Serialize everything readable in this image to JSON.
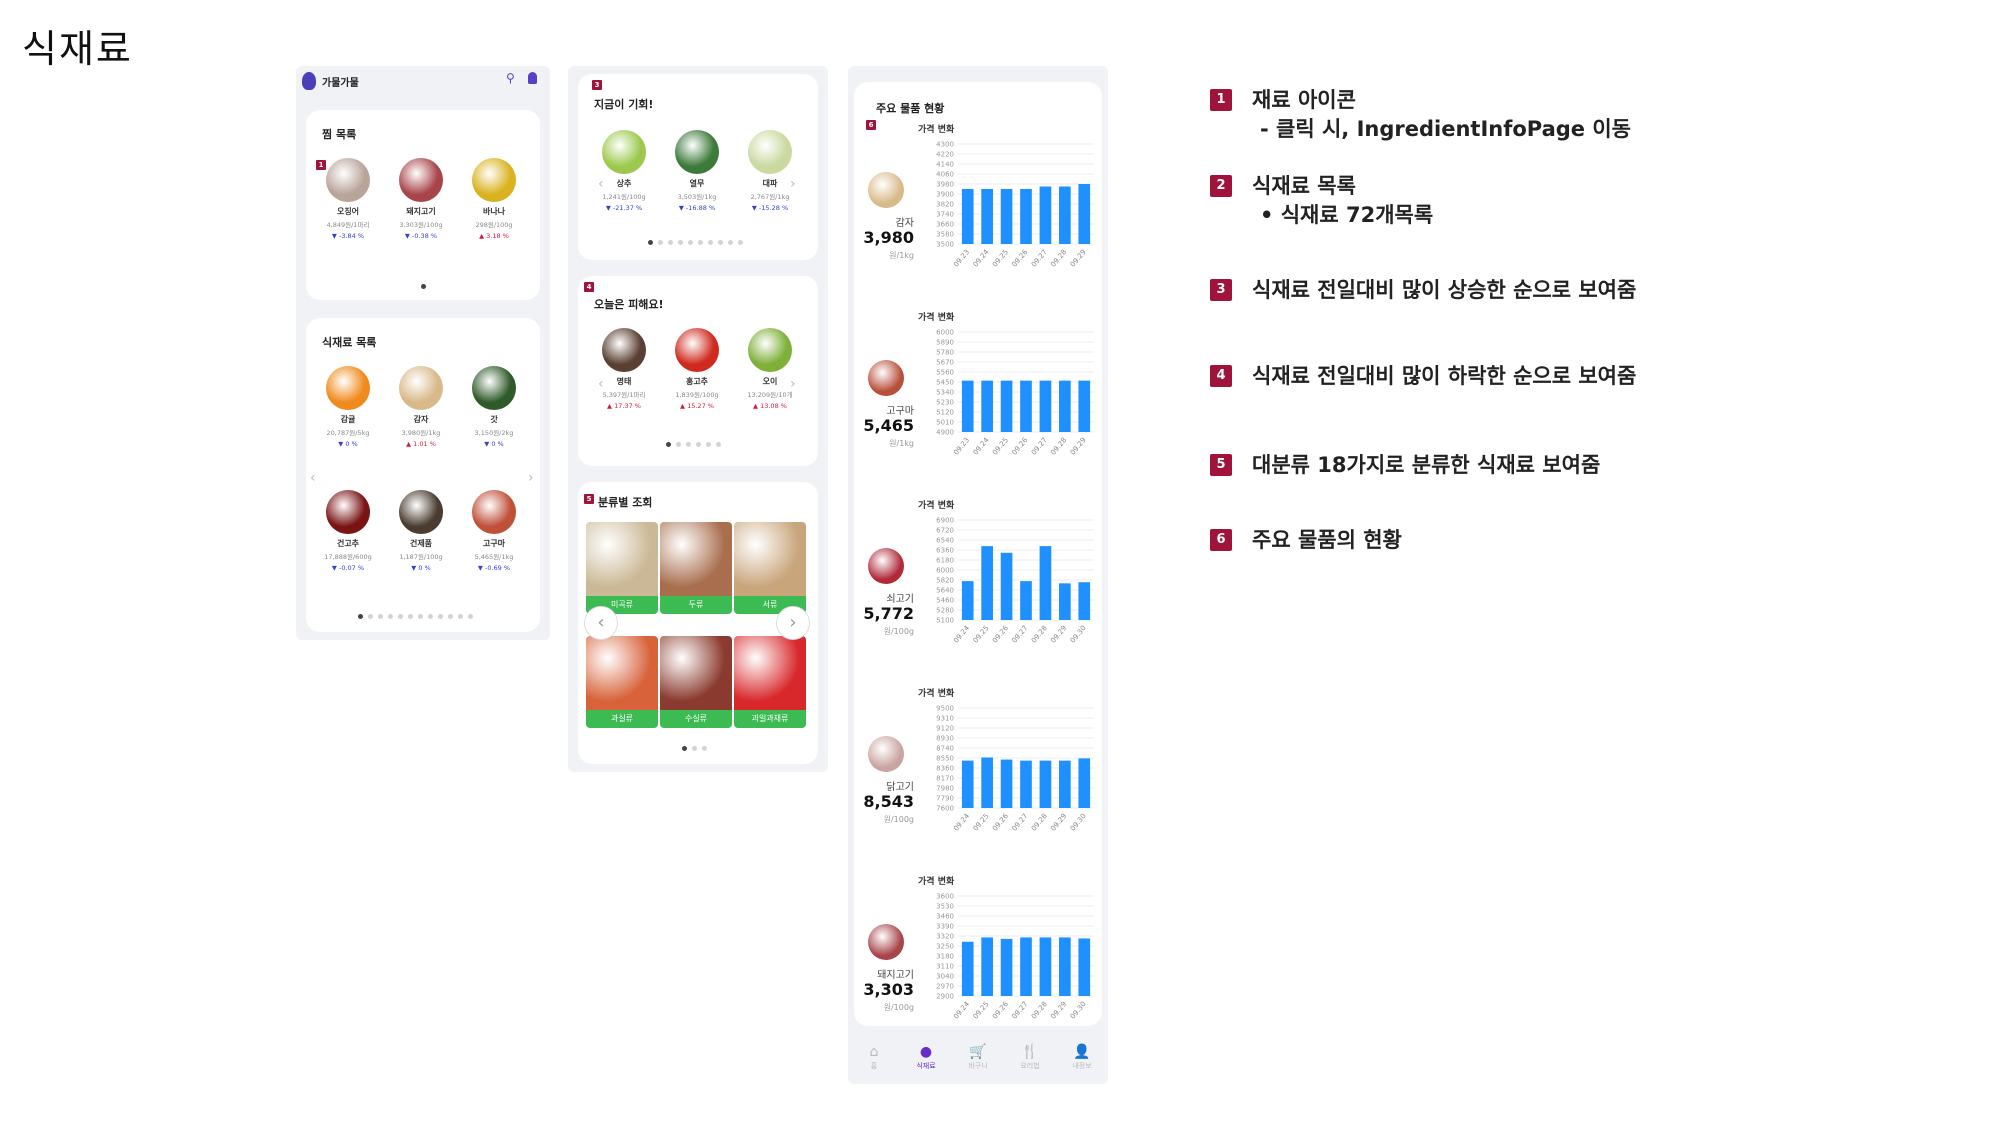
{
  "page_title": "식재료",
  "app": {
    "name": "가물가물",
    "colors": {
      "accent": "#a0143c",
      "brand": "#6a2cc7",
      "green": "#3dbb53",
      "bar": "#1e90ff",
      "down": "#3344cc",
      "up": "#d61b3a"
    }
  },
  "favorites": {
    "badge": "1",
    "title": "찜 목록",
    "items": [
      {
        "name": "오징어",
        "price": "4,849원/1마리",
        "change": "▼ -3.84 %",
        "dir": "dn",
        "color": "#b9a49a"
      },
      {
        "name": "돼지고기",
        "price": "3,303원/100g",
        "change": "▼ -0.38 %",
        "dir": "dn",
        "color": "#a8454a"
      },
      {
        "name": "바나나",
        "price": "298원/100g",
        "change": "▲ 3.18 %",
        "dir": "up",
        "color": "#d9b21f"
      }
    ]
  },
  "ingredients": {
    "badge": "2",
    "title": "식재료 목록",
    "items": [
      {
        "name": "감귤",
        "price": "20,787원/5kg",
        "change": "▼ 0 %",
        "dir": "dn",
        "color": "#f08a1c"
      },
      {
        "name": "감자",
        "price": "3,980원/1kg",
        "change": "▲ 1.01 %",
        "dir": "up",
        "color": "#d9b98a"
      },
      {
        "name": "갓",
        "price": "3,150원/2kg",
        "change": "▼ 0 %",
        "dir": "dn",
        "color": "#2f5a2a"
      },
      {
        "name": "건고추",
        "price": "17,888원/600g",
        "change": "▼ -0.07 %",
        "dir": "dn",
        "color": "#7a1414"
      },
      {
        "name": "건제품",
        "price": "1,187원/100g",
        "change": "▼ 0 %",
        "dir": "dn",
        "color": "#4a3c30"
      },
      {
        "name": "고구마",
        "price": "5,465원/1kg",
        "change": "▼ -0.69 %",
        "dir": "dn",
        "color": "#c0503a"
      }
    ]
  },
  "rising": {
    "badge": "3",
    "title": "지금이 기회!",
    "items": [
      {
        "name": "상추",
        "price": "1,241원/100g",
        "change": "▼ -21.37 %",
        "dir": "dn",
        "color": "#9cc94d"
      },
      {
        "name": "열무",
        "price": "3,503원/1kg",
        "change": "▼ -16.88 %",
        "dir": "dn",
        "color": "#3c7a3a"
      },
      {
        "name": "대파",
        "price": "2,767원/1kg",
        "change": "▼ -15.28 %",
        "dir": "dn",
        "color": "#c9d9a0"
      }
    ]
  },
  "falling": {
    "badge": "4",
    "title": "오늘은 피해요!",
    "items": [
      {
        "name": "명태",
        "price": "5,397원/1마리",
        "change": "▲ 17.37 %",
        "dir": "up",
        "color": "#5a4032"
      },
      {
        "name": "홍고추",
        "price": "1,839원/100g",
        "change": "▲ 15.27 %",
        "dir": "up",
        "color": "#cf2a1e"
      },
      {
        "name": "오이",
        "price": "13,209원/10개",
        "change": "▲ 13.08 %",
        "dir": "up",
        "color": "#7fb03a"
      }
    ]
  },
  "categories": {
    "badge": "5",
    "title": "분류별 조회",
    "items": [
      {
        "label": "미곡류",
        "color": "#cbb896"
      },
      {
        "label": "두류",
        "color": "#a86e4e"
      },
      {
        "label": "서류",
        "color": "#c9a57c"
      },
      {
        "label": "과실류",
        "color": "#d8623a"
      },
      {
        "label": "수실류",
        "color": "#8a3a2e"
      },
      {
        "label": "과일과채류",
        "color": "#d8282c"
      }
    ]
  },
  "stats": {
    "title": "주요 물품 현황",
    "badge": "6",
    "chart_title": "가격 변화",
    "items": [
      {
        "name": "감자",
        "value": "3,980",
        "unit": "원/1kg",
        "color": "#d8b98a"
      },
      {
        "name": "고구마",
        "value": "5,465",
        "unit": "원/1kg",
        "color": "#b8503a"
      },
      {
        "name": "쇠고기",
        "value": "5,772",
        "unit": "원/100g",
        "color": "#b02a3a"
      },
      {
        "name": "닭고기",
        "value": "8,543",
        "unit": "원/100g",
        "color": "#c9a4a0"
      },
      {
        "name": "돼지고기",
        "value": "3,303",
        "unit": "원/100g",
        "color": "#a8454a"
      }
    ]
  },
  "chart_data": [
    {
      "type": "bar",
      "title": "가격 변화",
      "categories": [
        "09.23",
        "09.24",
        "09.25",
        "09.26",
        "09.27",
        "09.28",
        "09.29"
      ],
      "values": [
        3940,
        3940,
        3940,
        3940,
        3960,
        3960,
        3980
      ],
      "y_ticks": [
        "4300",
        "4220",
        "4140",
        "4060",
        "3980",
        "3900",
        "3820",
        "3740",
        "3660",
        "3580",
        "3500"
      ],
      "ylim": [
        3500,
        4300
      ]
    },
    {
      "type": "bar",
      "title": "가격 변화",
      "categories": [
        "09.23",
        "09.24",
        "09.25",
        "09.26",
        "09.27",
        "09.28",
        "09.29"
      ],
      "values": [
        5465,
        5465,
        5465,
        5465,
        5465,
        5465,
        5465
      ],
      "y_ticks": [
        "6000",
        "5890",
        "5780",
        "5670",
        "5560",
        "5450",
        "5340",
        "5230",
        "5120",
        "5010",
        "4900"
      ],
      "ylim": [
        4900,
        6000
      ]
    },
    {
      "type": "bar",
      "title": "가격 변화",
      "categories": [
        "09.24",
        "09.25",
        "09.26",
        "09.27",
        "09.28",
        "09.29",
        "09.30"
      ],
      "values": [
        5800,
        6430,
        6310,
        5800,
        6430,
        5760,
        5780
      ],
      "y_ticks": [
        "6900",
        "6720",
        "6540",
        "6360",
        "6180",
        "6000",
        "5820",
        "5640",
        "5460",
        "5280",
        "5100"
      ],
      "ylim": [
        5100,
        6900
      ]
    },
    {
      "type": "bar",
      "title": "가격 변화",
      "categories": [
        "09.24",
        "09.25",
        "09.26",
        "09.27",
        "09.28",
        "09.29",
        "09.30"
      ],
      "values": [
        8500,
        8560,
        8520,
        8500,
        8500,
        8500,
        8543
      ],
      "y_ticks": [
        "9500",
        "9310",
        "9120",
        "8930",
        "8740",
        "8550",
        "8360",
        "8170",
        "7980",
        "7790",
        "7600"
      ],
      "ylim": [
        7600,
        9500
      ]
    },
    {
      "type": "bar",
      "title": "가격 변화",
      "categories": [
        "09.24",
        "09.25",
        "09.26",
        "09.27",
        "09.28",
        "09.29",
        "09.30"
      ],
      "values": [
        3280,
        3310,
        3300,
        3310,
        3310,
        3310,
        3303
      ],
      "y_ticks": [
        "3600",
        "3530",
        "3460",
        "3390",
        "3320",
        "3250",
        "3180",
        "3110",
        "3040",
        "2970",
        "2900"
      ],
      "ylim": [
        2900,
        3600
      ]
    }
  ],
  "bottom_nav": [
    {
      "label": "홈",
      "icon": "⌂",
      "active": false
    },
    {
      "label": "식재료",
      "icon": "●",
      "active": true
    },
    {
      "label": "바구니",
      "icon": "🛒",
      "active": false
    },
    {
      "label": "요리법",
      "icon": "🍴",
      "active": false
    },
    {
      "label": "내정보",
      "icon": "👤",
      "active": false
    }
  ],
  "notes": [
    {
      "num": "1",
      "title": "재료 아이콘",
      "sub": "- 클릭 시, IngredientInfoPage 이동"
    },
    {
      "num": "2",
      "title": "식재료 목록",
      "sub": "• 식재료 72개목록"
    },
    {
      "num": "3",
      "title": "식재료 전일대비 많이 상승한 순으로 보여줌",
      "sub": ""
    },
    {
      "num": "4",
      "title": "식재료 전일대비 많이 하락한 순으로 보여줌",
      "sub": ""
    },
    {
      "num": "5",
      "title": "대분류 18가지로 분류한 식재료 보여줌",
      "sub": ""
    },
    {
      "num": "6",
      "title": "주요 물품의 현황",
      "sub": ""
    }
  ]
}
